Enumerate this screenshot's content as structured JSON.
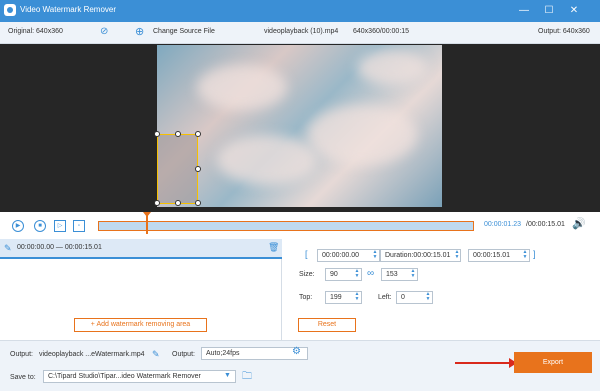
{
  "window": {
    "title": "Video Watermark Remover",
    "minimize": "—",
    "maximize": "☐",
    "close": "✕"
  },
  "info": {
    "original": "Original: 640x360",
    "change_source": "Change Source File",
    "filename": "videoplayback (10).mp4",
    "meta": "640x360/00:00:15",
    "output": "Output: 640x360"
  },
  "playback": {
    "current": "00:00:01.23",
    "total": "/00:00:15.01"
  },
  "segment": {
    "range": "00:00:00.00 — 00:00:15.01",
    "add_label": "Add watermark removing area"
  },
  "controls": {
    "start": "00:00:00.00",
    "duration": "Duration:00:00:15.01",
    "end": "00:00:15.01",
    "size_label": "Size:",
    "width": "90",
    "height": "153",
    "top_label": "Top:",
    "top": "199",
    "left_label": "Left:",
    "left": "0",
    "reset": "Reset"
  },
  "bottom": {
    "output_label": "Output:",
    "output_file": "videoplayback ...eWatermark.mp4",
    "output_fmt_label": "Output:",
    "output_fmt": "Auto;24fps",
    "save_label": "Save to:",
    "save_path": "C:\\Tipard Studio\\Tipar...ideo Watermark Remover",
    "export": "Export"
  },
  "colors": {
    "accent": "#3b8fd6",
    "orange": "#e8731c",
    "arrow": "#d9291c"
  }
}
